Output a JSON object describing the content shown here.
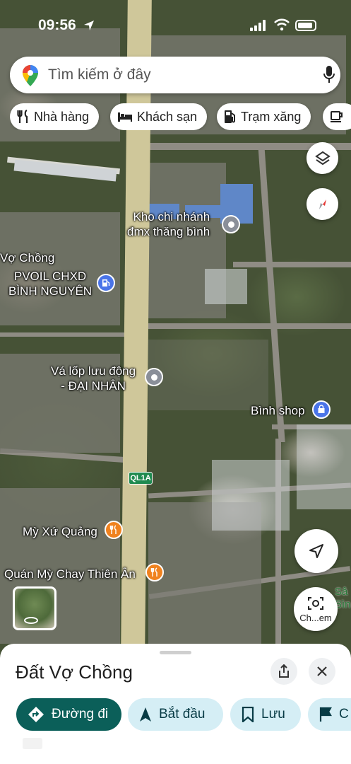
{
  "status_bar": {
    "time": "09:56"
  },
  "search": {
    "placeholder": "Tìm kiếm ở đây"
  },
  "chips": [
    {
      "label": "Nhà hàng",
      "icon": "fork-knife-icon"
    },
    {
      "label": "Khách sạn",
      "icon": "bed-icon"
    },
    {
      "label": "Trạm xăng",
      "icon": "gas-pump-icon"
    },
    {
      "label": "",
      "icon": "coffee-icon"
    }
  ],
  "map": {
    "places": {
      "kho": "Kho chi nhánh\nđmx thăng bình",
      "vochong_edge": "Vợ Chồng",
      "pvoil": "PVOIL CHXD\nBÌNH NGUYÊN",
      "valop": "Vá lốp lưu động\n- ĐẠI NHÂN",
      "binhshop": "Bình shop",
      "myxu": "Mỳ Xứ Quảng",
      "quanmy": "Quán Mỳ Chay Thiên Ân"
    },
    "road_shield": "QL1A",
    "right_partial": "Sâ\nBìn",
    "street_view_label": "Ch...em"
  },
  "colors": {
    "primary": "#0b5f59",
    "secondary_bg": "#d5eef5",
    "gas_marker": "#4a74e8",
    "food_marker": "#f0821f",
    "place_marker": "#8a8f99"
  },
  "sheet": {
    "title": "Đất Vợ Chồng",
    "actions": {
      "directions": "Đường đi",
      "start": "Bắt đầu",
      "save": "Lưu",
      "more": "C"
    }
  }
}
